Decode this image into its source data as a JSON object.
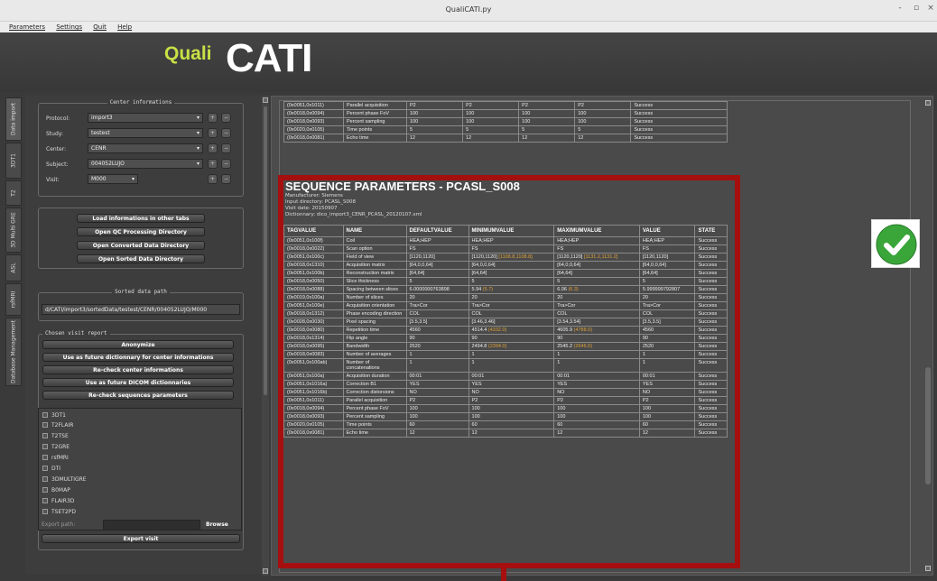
{
  "window": {
    "title": "QualiCATI.py",
    "controls": [
      "-",
      "▫",
      "×"
    ]
  },
  "menu": [
    "Parameters",
    "Settings",
    "Quit",
    "Help"
  ],
  "logo": {
    "part1": "Quali",
    "part2": "CATI"
  },
  "vtabs": [
    "Data import",
    "3DT1",
    "T2",
    "3D Multi GRE",
    "ASL",
    "rsfMRI",
    "Database Management"
  ],
  "center": {
    "title": "Center informations",
    "fields": [
      {
        "label": "Protocol:",
        "value": "import3"
      },
      {
        "label": "Study:",
        "value": "testest"
      },
      {
        "label": "Center:",
        "value": "CENR"
      },
      {
        "label": "Subject:",
        "value": "004052LUJO"
      },
      {
        "label": "Visit:",
        "value": "M000"
      }
    ]
  },
  "actions": [
    "Load informations in other tabs",
    "Open QC Processing Directory",
    "Open Converted Data Directory",
    "Open Sorted Data Directory"
  ],
  "sorted": {
    "title": "Sorted data path",
    "path": "d/CATI/import3/sortedData/testest/CENR/004052LUJO/M000"
  },
  "visit_report": {
    "title": "Chosen visit report",
    "buttons": [
      "Anonymize",
      "Use as future dictionnary for center informations",
      "Re-check center informations",
      "Use as future DICOM dictionnaries",
      "Re-check sequences parameters"
    ],
    "sequences": [
      "3DT1",
      "T2FLAIR",
      "T2TSE",
      "T2GRE",
      "rsfMRI",
      "DTI",
      "3DMULTIGRE",
      "B0MAP",
      "FLAIR3D",
      "TSET2PD"
    ]
  },
  "export": {
    "label": "Export path:",
    "browse": "Browse",
    "button": "Export visit"
  },
  "top_rows": [
    [
      "(0x0051,0x1011)",
      "Parallel acquisition",
      "P2",
      "P2",
      "P2",
      "P2",
      "Success"
    ],
    [
      "(0x0018,0x0094)",
      "Percent phase FoV",
      "100",
      "100",
      "100",
      "100",
      "Success"
    ],
    [
      "(0x0018,0x0093)",
      "Percent sampling",
      "100",
      "100",
      "100",
      "100",
      "Success"
    ],
    [
      "(0x0020,0x0105)",
      "Time points",
      "5",
      "5",
      "5",
      "5",
      "Success"
    ],
    [
      "(0x0018,0x0081)",
      "Echo time",
      "12",
      "12",
      "12",
      "12",
      "Success"
    ]
  ],
  "sequence": {
    "title": "SEQUENCE PARAMETERS - PCASL_S008",
    "meta": [
      "Manufacturer: Siemens",
      "Input directory: PCASL_S008",
      "Visit date: 20150907",
      "Dictionnary: dico_import3_CENR_PCASL_20120107.xml"
    ],
    "headers": [
      "TAGVALUE",
      "NAME",
      "DEFAULTVALUE",
      "MINIMUMVALUE",
      "MAXIMUMVALUE",
      "VALUE",
      "STATE"
    ],
    "rows": [
      {
        "tag": "(0x0051,0x100f)",
        "name": "Coil",
        "def": "HEA;HEP",
        "min": "HEA;HEP",
        "minw": "",
        "max": "HEA;HEP",
        "maxw": "",
        "val": "HEA;HEP",
        "state": "Success"
      },
      {
        "tag": "(0x0018,0x0022)",
        "name": "Scan option",
        "def": "FS",
        "min": "FS",
        "minw": "",
        "max": "FS",
        "maxw": "",
        "val": "FS",
        "state": "Success"
      },
      {
        "tag": "(0x0051,0x100c)",
        "name": "Field of view",
        "def": "[1120,1120]",
        "min": "[1120,1120]",
        "minw": "[1108.8,1108.8]",
        "max": "[1120,1120]",
        "maxw": "[1131.2,1131.2]",
        "val": "[1120,1120]",
        "state": "Success"
      },
      {
        "tag": "(0x0018,0x1310)",
        "name": "Acquisition matrix",
        "def": "[64,0,0,64]",
        "min": "[64,0,0,64]",
        "minw": "",
        "max": "[64,0,0,64]",
        "maxw": "",
        "val": "[64,0,0,64]",
        "state": "Success"
      },
      {
        "tag": "(0x0051,0x100b)",
        "name": "Reconstruction matrix",
        "def": "[64,64]",
        "min": "[64,64]",
        "minw": "",
        "max": "[64,64]",
        "maxw": "",
        "val": "[64,64]",
        "state": "Success"
      },
      {
        "tag": "(0x0018,0x0050)",
        "name": "Slice thickness",
        "def": "5",
        "min": "5",
        "minw": "",
        "max": "5",
        "maxw": "",
        "val": "5",
        "state": "Success"
      },
      {
        "tag": "(0x0018,0x0088)",
        "name": "Spacing between slices",
        "def": "6.0000000763898",
        "min": "5.94",
        "minw": "(5.7)",
        "max": "6.06",
        "maxw": "(6.3)",
        "val": "5.999999792807",
        "state": "Success"
      },
      {
        "tag": "(0x0019,0x100a)",
        "name": "Number of slices",
        "def": "20",
        "min": "20",
        "minw": "",
        "max": "20",
        "maxw": "",
        "val": "20",
        "state": "Success"
      },
      {
        "tag": "(0x0051,0x100e)",
        "name": "Acquisition orientation",
        "def": "Tra>Cor",
        "min": "Tra>Cor",
        "minw": "",
        "max": "Tra>Cor",
        "maxw": "",
        "val": "Tra>Cor",
        "state": "Success"
      },
      {
        "tag": "(0x0018,0x1312)",
        "name": "Phase encoding direction",
        "def": "COL",
        "min": "COL",
        "minw": "",
        "max": "COL",
        "maxw": "",
        "val": "COL",
        "state": "Success"
      },
      {
        "tag": "(0x0028,0x0030)",
        "name": "Pixel spacing",
        "def": "[3.5,3.5]",
        "min": "[3.46,3.46]",
        "minw": "",
        "max": "[3.54,3.54]",
        "maxw": "",
        "val": "[3.5,3.5]",
        "state": "Success"
      },
      {
        "tag": "(0x0018,0x0080)",
        "name": "Repetition time",
        "def": "4560",
        "min": "4514.4",
        "minw": "(4332.0)",
        "max": "4605.9",
        "maxw": "(4788.0)",
        "val": "4560",
        "state": "Success"
      },
      {
        "tag": "(0x0018,0x1314)",
        "name": "Flip angle",
        "def": "90",
        "min": "90",
        "minw": "",
        "max": "90",
        "maxw": "",
        "val": "90",
        "state": "Success"
      },
      {
        "tag": "(0x0018,0x0095)",
        "name": "Bandwidth",
        "def": "2520",
        "min": "2494.8",
        "minw": "(2394.0)",
        "max": "2545.2",
        "maxw": "(2646.0)",
        "val": "2520",
        "state": "Success"
      },
      {
        "tag": "(0x0018,0x0083)",
        "name": "Number of averages",
        "def": "1",
        "min": "1",
        "minw": "",
        "max": "1",
        "maxw": "",
        "val": "1",
        "state": "Success"
      },
      {
        "tag": "(0x0051,0x100ab)",
        "name": "Number of concatenations",
        "def": "1",
        "min": "1",
        "minw": "",
        "max": "1",
        "maxw": "",
        "val": "1",
        "state": "Success"
      },
      {
        "tag": "(0x0051,0x100a)",
        "name": "Acquisition duration",
        "def": "00:01",
        "min": "00:01",
        "minw": "",
        "max": "00:01",
        "maxw": "",
        "val": "00:01",
        "state": "Success"
      },
      {
        "tag": "(0x0051,0x1016a)",
        "name": "Correction B1",
        "def": "YES",
        "min": "YES",
        "minw": "",
        "max": "YES",
        "maxw": "",
        "val": "YES",
        "state": "Success"
      },
      {
        "tag": "(0x0051,0x1016b)",
        "name": "Correction distorsions",
        "def": "NO",
        "min": "NO",
        "minw": "",
        "max": "NO",
        "maxw": "",
        "val": "NO",
        "state": "Success"
      },
      {
        "tag": "(0x0051,0x1011)",
        "name": "Parallel acquisition",
        "def": "P2",
        "min": "P2",
        "minw": "",
        "max": "P2",
        "maxw": "",
        "val": "P2",
        "state": "Success"
      },
      {
        "tag": "(0x0018,0x0094)",
        "name": "Percent phase FoV",
        "def": "100",
        "min": "100",
        "minw": "",
        "max": "100",
        "maxw": "",
        "val": "100",
        "state": "Success"
      },
      {
        "tag": "(0x0018,0x0093)",
        "name": "Percent sampling",
        "def": "100",
        "min": "100",
        "minw": "",
        "max": "100",
        "maxw": "",
        "val": "100",
        "state": "Success"
      },
      {
        "tag": "(0x0020,0x0105)",
        "name": "Time points",
        "def": "60",
        "min": "60",
        "minw": "",
        "max": "60",
        "maxw": "",
        "val": "60",
        "state": "Success"
      },
      {
        "tag": "(0x0018,0x0081)",
        "name": "Echo time",
        "def": "12",
        "min": "12",
        "minw": "",
        "max": "12",
        "maxw": "",
        "val": "12",
        "state": "Success"
      }
    ]
  },
  "colors": {
    "accent_red": "#a50f0f",
    "success_green": "#3aa63a",
    "logo_green": "#c9e046",
    "warn": "#e0a23a"
  }
}
